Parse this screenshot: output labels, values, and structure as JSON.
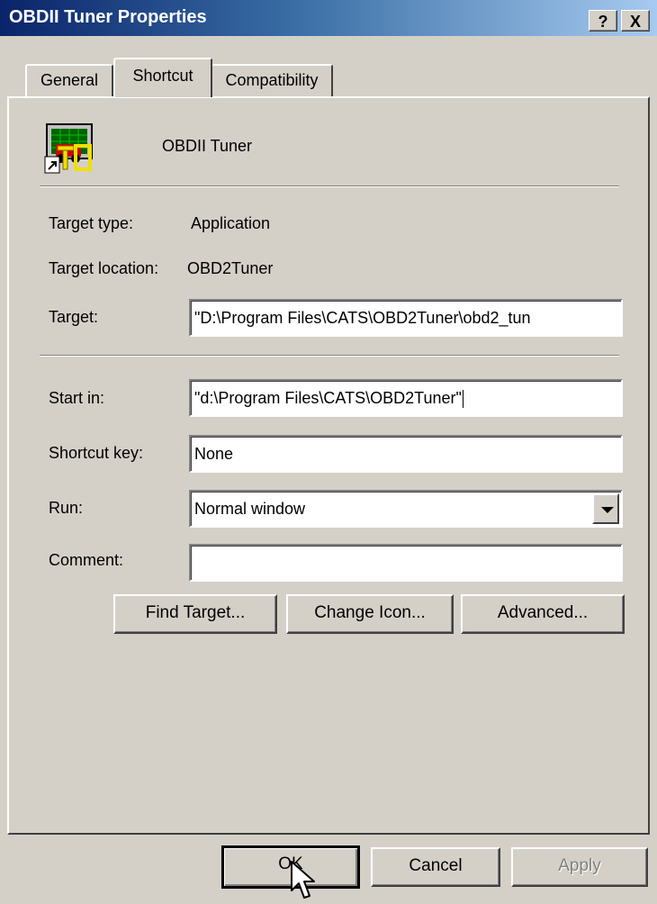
{
  "window": {
    "title": "OBDII Tuner Properties",
    "help_label": "?",
    "close_label": "X"
  },
  "tabs": [
    {
      "label": "General",
      "active": false
    },
    {
      "label": "Shortcut",
      "active": true
    },
    {
      "label": "Compatibility",
      "active": false
    }
  ],
  "shortcut": {
    "icon": "obdii-tuner-app-icon",
    "name": "OBDII Tuner",
    "target_type_label": "Target type:",
    "target_type_value": "Application",
    "target_location_label": "Target location:",
    "target_location_value": "OBD2Tuner",
    "target_label": "Target:",
    "target_value": "\"D:\\Program Files\\CATS\\OBD2Tuner\\obd2_tun",
    "start_in_label": "Start in:",
    "start_in_value": "\"d:\\Program Files\\CATS\\OBD2Tuner\"",
    "shortcut_key_label": "Shortcut key:",
    "shortcut_key_value": "None",
    "run_label": "Run:",
    "run_value": "Normal window",
    "comment_label": "Comment:",
    "comment_value": "",
    "find_target_label": "Find Target...",
    "change_icon_label": "Change Icon...",
    "advanced_label": "Advanced..."
  },
  "footer": {
    "ok_label": "OK",
    "cancel_label": "Cancel",
    "apply_label": "Apply"
  },
  "colors": {
    "titlebar_start": "#0a246a",
    "titlebar_end": "#a6caf0",
    "face": "#d4d0c8"
  }
}
